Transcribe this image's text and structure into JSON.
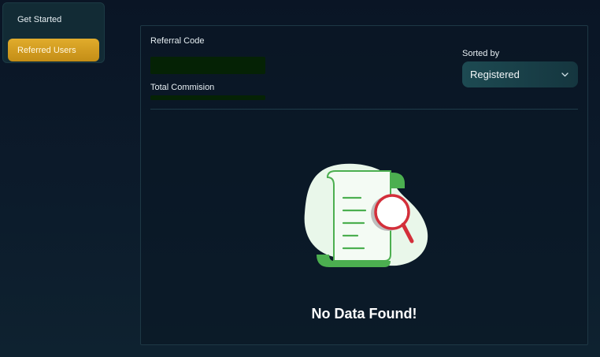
{
  "sidebar": {
    "items": [
      {
        "label": "Get Started",
        "active": false
      },
      {
        "label": "Referred Users",
        "active": true
      }
    ]
  },
  "summary": {
    "referral_code_label": "Referral Code",
    "total_commission_label": "Total Commision"
  },
  "sort": {
    "label": "Sorted by",
    "selected": "Registered"
  },
  "empty_state": {
    "message": "No Data Found!",
    "icon": "document-search-icon"
  },
  "colors": {
    "accent": "#d9a424",
    "illustration_green": "#4caf50",
    "magnifier_red": "#d32f3a"
  }
}
